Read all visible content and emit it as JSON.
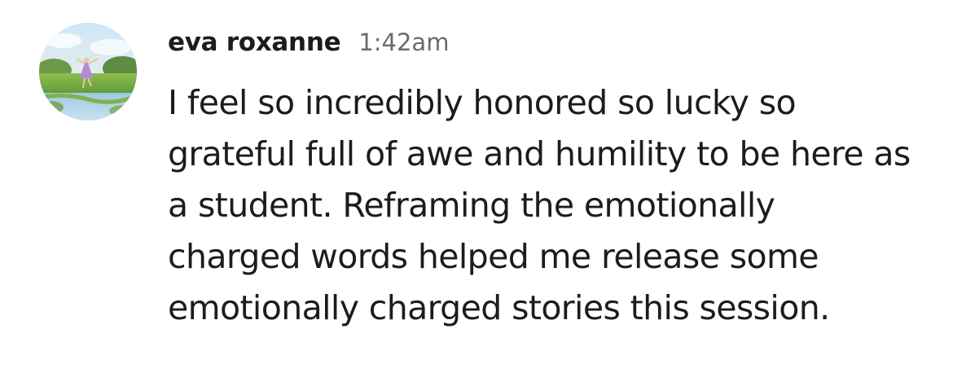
{
  "message": {
    "author": "eva roxanne",
    "timestamp": "1:42am",
    "text": "I feel so incredibly honored so lucky so grateful full of awe and humility to be here as a student. Reframing the emotionally charged words helped me release some emotionally charged stories this session.",
    "avatar_icon": "painted-landscape-avatar"
  }
}
